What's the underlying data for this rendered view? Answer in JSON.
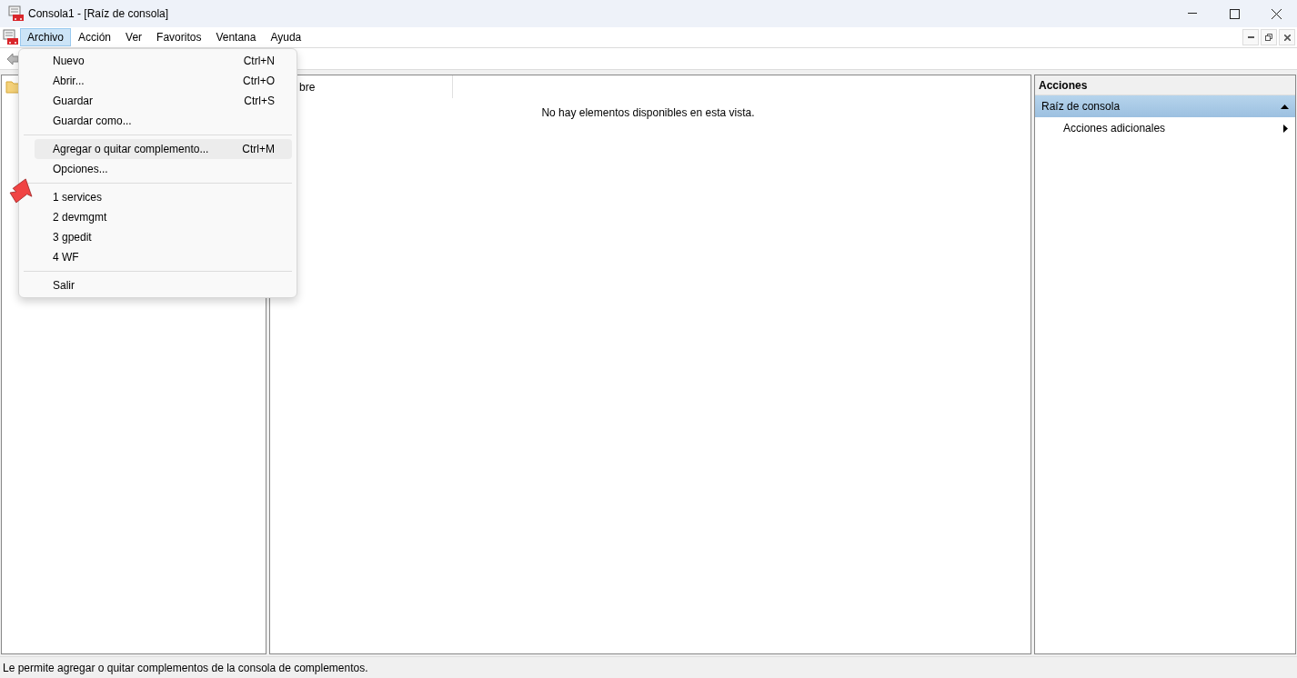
{
  "window": {
    "title": "Consola1 - [Raíz de consola]"
  },
  "menu_bar": [
    {
      "label": "Archivo",
      "selected": true
    },
    {
      "label": "Acción",
      "selected": false
    },
    {
      "label": "Ver",
      "selected": false
    },
    {
      "label": "Favoritos",
      "selected": false
    },
    {
      "label": "Ventana",
      "selected": false
    },
    {
      "label": "Ayuda",
      "selected": false
    }
  ],
  "file_menu": {
    "groups": [
      [
        {
          "label": "Nuevo",
          "shortcut": "Ctrl+N",
          "selected": false
        },
        {
          "label": "Abrir...",
          "shortcut": "Ctrl+O",
          "selected": false
        },
        {
          "label": "Guardar",
          "shortcut": "Ctrl+S",
          "selected": false
        },
        {
          "label": "Guardar como...",
          "selected": false
        }
      ],
      [
        {
          "label": "Agregar o quitar complemento...",
          "shortcut": "Ctrl+M",
          "selected": true
        },
        {
          "label": "Opciones...",
          "selected": false
        }
      ],
      [
        {
          "label": "1 services",
          "selected": false
        },
        {
          "label": "2 devmgmt",
          "selected": false
        },
        {
          "label": "3 gpedit",
          "selected": false
        },
        {
          "label": "4 WF",
          "selected": false
        }
      ],
      [
        {
          "label": "Salir",
          "selected": false
        }
      ]
    ]
  },
  "list": {
    "column_1": "bre",
    "empty_message": "No hay elementos disponibles en esta vista."
  },
  "actions": {
    "title": "Acciones",
    "sections": [
      {
        "label": "Raíz de consola",
        "expanded": true,
        "items": [
          {
            "label": "Acciones adicionales"
          }
        ]
      }
    ]
  },
  "status_bar": "Le permite agregar o quitar complementos de la consola de complementos."
}
